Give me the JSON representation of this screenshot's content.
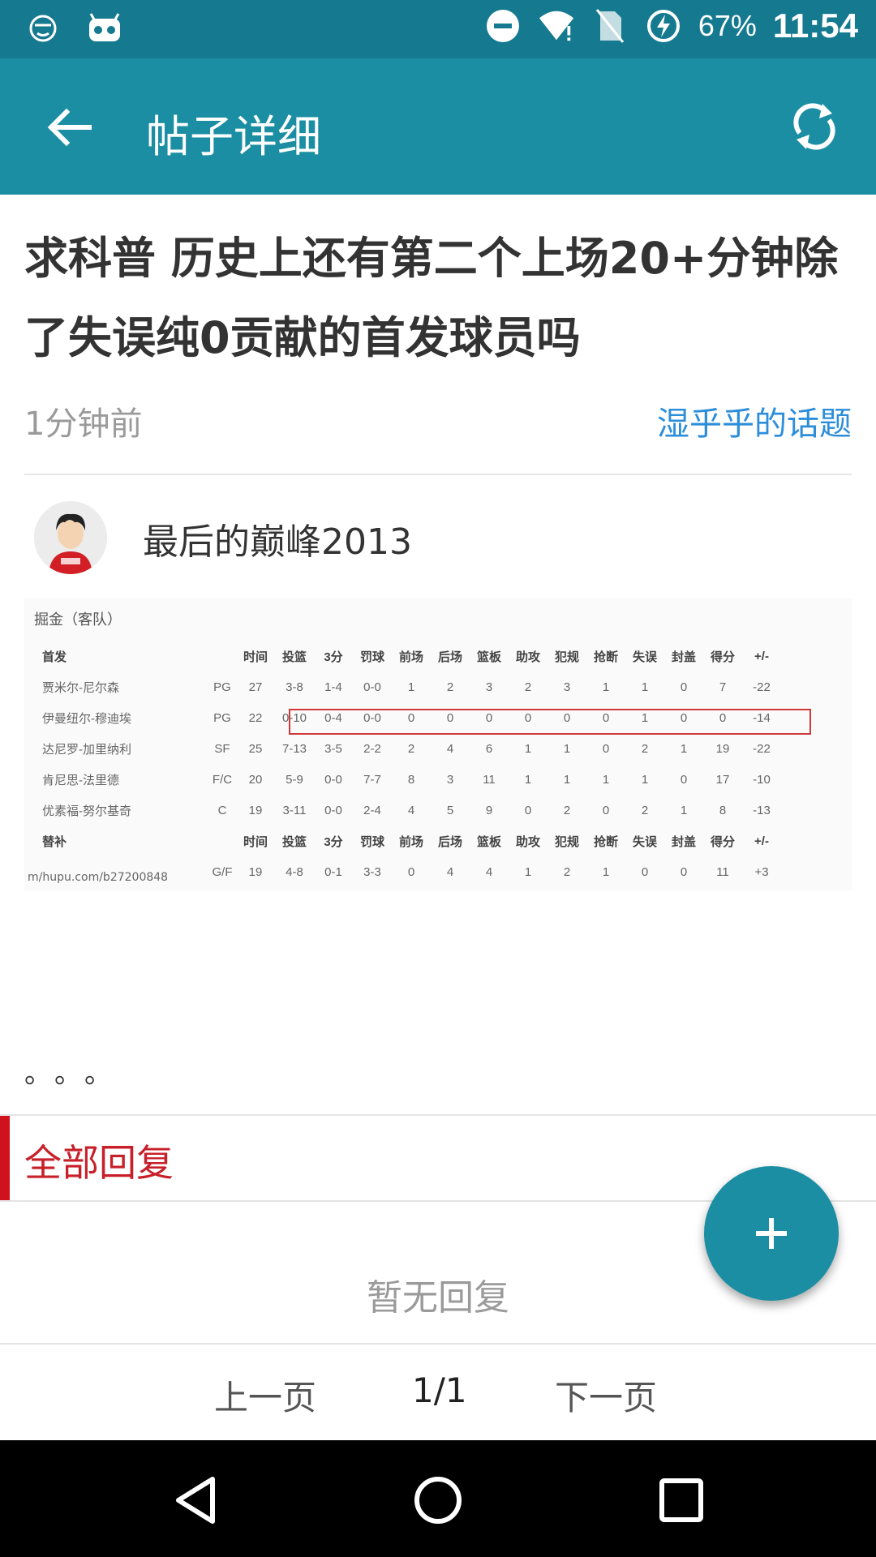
{
  "status_bar": {
    "battery": "67%",
    "time": "11:54",
    "icons": [
      "smiley-icon",
      "android-robot-icon",
      "do-not-disturb-icon",
      "wifi-icon",
      "no-sim-icon",
      "battery-charging-icon"
    ]
  },
  "app_bar": {
    "title": "帖子详细",
    "back_icon": "arrow-left-icon",
    "refresh_icon": "refresh-icon"
  },
  "post": {
    "title": "求科普 历史上还有第二个上场20+分钟除了失误纯0贡献的首发球员吗",
    "time": "1分钟前",
    "topic": "湿乎乎的话题",
    "author": "最后的巅峰2013",
    "trailing_dots": "。。。"
  },
  "stats_image": {
    "team_label": "掘金（客队）",
    "header_starters": [
      "首发",
      "",
      "时间",
      "投篮",
      "3分",
      "罚球",
      "前场",
      "后场",
      "篮板",
      "助攻",
      "犯规",
      "抢断",
      "失误",
      "封盖",
      "得分",
      "+/-"
    ],
    "rows": [
      [
        "贾米尔-尼尔森",
        "PG",
        "27",
        "3-8",
        "1-4",
        "0-0",
        "1",
        "2",
        "3",
        "2",
        "3",
        "1",
        "1",
        "0",
        "7",
        "-22"
      ],
      [
        "伊曼纽尔-穆迪埃",
        "PG",
        "22",
        "0-10",
        "0-4",
        "0-0",
        "0",
        "0",
        "0",
        "0",
        "0",
        "0",
        "1",
        "0",
        "0",
        "-14"
      ],
      [
        "达尼罗-加里纳利",
        "SF",
        "25",
        "7-13",
        "3-5",
        "2-2",
        "2",
        "4",
        "6",
        "1",
        "1",
        "0",
        "2",
        "1",
        "19",
        "-22"
      ],
      [
        "肯尼思-法里德",
        "F/C",
        "20",
        "5-9",
        "0-0",
        "7-7",
        "8",
        "3",
        "11",
        "1",
        "1",
        "1",
        "1",
        "0",
        "17",
        "-10"
      ],
      [
        "优素福-努尔基奇",
        "C",
        "19",
        "3-11",
        "0-0",
        "2-4",
        "4",
        "5",
        "9",
        "0",
        "2",
        "0",
        "2",
        "1",
        "8",
        "-13"
      ]
    ],
    "header_bench": [
      "替补",
      "",
      "时间",
      "投篮",
      "3分",
      "罚球",
      "前场",
      "后场",
      "篮板",
      "助攻",
      "犯规",
      "抢断",
      "失误",
      "封盖",
      "得分",
      "+/-"
    ],
    "bench_rows": [
      [
        "",
        "G/F",
        "19",
        "4-8",
        "0-1",
        "3-3",
        "0",
        "4",
        "4",
        "1",
        "2",
        "1",
        "0",
        "0",
        "11",
        "+3"
      ]
    ],
    "watermark": "m/hupu.com/b27200848"
  },
  "replies": {
    "header": "全部回复",
    "empty": "暂无回复"
  },
  "pager": {
    "prev": "上一页",
    "page": "1/1",
    "next": "下一页"
  },
  "colors": {
    "status_bar": "#15798f",
    "app_bar": "#1b8ea3",
    "accent_red": "#c8202a",
    "link_blue": "#2c8ed9"
  }
}
